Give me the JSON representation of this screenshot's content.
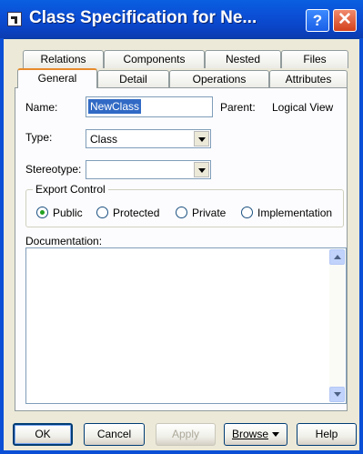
{
  "window": {
    "title": "Class Specification for Ne...",
    "help_glyph": "?",
    "close_glyph": "✕"
  },
  "tabs_back": [
    "Relations",
    "Components",
    "Nested",
    "Files"
  ],
  "tabs_front": [
    "General",
    "Detail",
    "Operations",
    "Attributes"
  ],
  "active_tab": "General",
  "form": {
    "name_label": "Name:",
    "name_value": "NewClass",
    "parent_label": "Parent:",
    "parent_value": "Logical View",
    "type_label": "Type:",
    "type_value": "Class",
    "stereotype_label": "Stereotype:",
    "stereotype_value": "",
    "export_control_label": "Export Control",
    "export_options": [
      "Public",
      "Protected",
      "Private",
      "Implementation"
    ],
    "export_selected": "Public",
    "documentation_label": "Documentation:",
    "documentation_value": ""
  },
  "buttons": {
    "ok": "OK",
    "cancel": "Cancel",
    "apply": "Apply",
    "browse": "Browse",
    "help": "Help"
  }
}
